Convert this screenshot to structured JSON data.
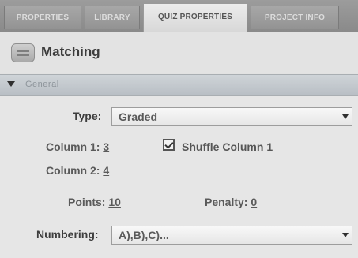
{
  "tabs": [
    {
      "label": "PROPERTIES"
    },
    {
      "label": "LIBRARY"
    },
    {
      "label": "QUIZ PROPERTIES"
    },
    {
      "label": "PROJECT INFO"
    }
  ],
  "header": {
    "title": "Matching"
  },
  "section": {
    "label": "General"
  },
  "form": {
    "type_label": "Type:",
    "type_value": "Graded",
    "column1_label": "Column 1:",
    "column1_value": "3",
    "shuffle_label": "Shuffle Column 1",
    "shuffle_checked": true,
    "column2_label": "Column 2:",
    "column2_value": "4",
    "points_label": "Points:",
    "points_value": "10",
    "penalty_label": "Penalty:",
    "penalty_value": "0",
    "numbering_label": "Numbering:",
    "numbering_value": "A),B),C)..."
  }
}
